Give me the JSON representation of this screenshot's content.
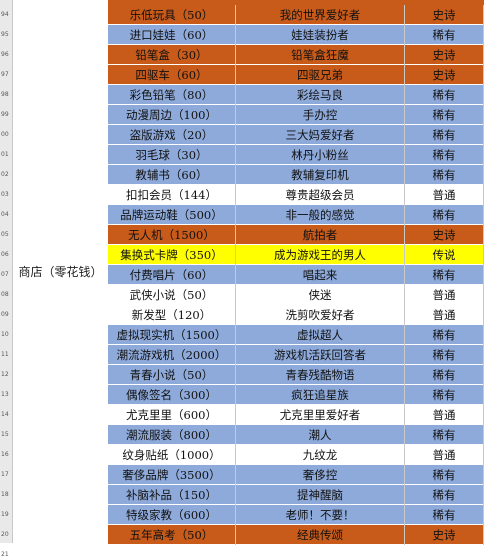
{
  "colors": {
    "orange": "#c85a1a",
    "blue": "#8eaadb",
    "white": "#ffffff",
    "yellow": "#ffff00"
  },
  "merged_label": "商店（零花钱）",
  "row_numbers": [
    "94",
    "95",
    "96",
    "97",
    "98",
    "99",
    "00",
    "01",
    "02",
    "03",
    "04",
    "05",
    "06",
    "07",
    "08",
    "09",
    "10",
    "11",
    "12",
    "13",
    "14",
    "15",
    "16",
    "17",
    "18",
    "19",
    "20",
    "21"
  ],
  "rows": [
    {
      "item": "乐低玩具（50）",
      "title": "我的世界爱好者",
      "rarity": "史诗",
      "color": "orange"
    },
    {
      "item": "进口娃娃（60）",
      "title": "娃娃装扮者",
      "rarity": "稀有",
      "color": "blue"
    },
    {
      "item": "铅笔盒（30）",
      "title": "铅笔盒狂魔",
      "rarity": "史诗",
      "color": "orange"
    },
    {
      "item": "四驱车（60）",
      "title": "四驱兄弟",
      "rarity": "史诗",
      "color": "orange"
    },
    {
      "item": "彩色铅笔（80）",
      "title": "彩绘马良",
      "rarity": "稀有",
      "color": "blue"
    },
    {
      "item": "动漫周边（100）",
      "title": "手办控",
      "rarity": "稀有",
      "color": "blue"
    },
    {
      "item": "盗版游戏（20）",
      "title": "三大妈爱好者",
      "rarity": "稀有",
      "color": "blue"
    },
    {
      "item": "羽毛球（30）",
      "title": "林丹小粉丝",
      "rarity": "稀有",
      "color": "blue"
    },
    {
      "item": "教辅书（60）",
      "title": "教辅复印机",
      "rarity": "稀有",
      "color": "blue"
    },
    {
      "item": "扣扣会员（144）",
      "title": "尊贵超级会员",
      "rarity": "普通",
      "color": "white"
    },
    {
      "item": "品牌运动鞋（500）",
      "title": "非一般的感觉",
      "rarity": "稀有",
      "color": "blue"
    },
    {
      "item": "无人机（1500）",
      "title": "航拍者",
      "rarity": "史诗",
      "color": "orange"
    },
    {
      "item": "集换式卡牌（350）",
      "title": "成为游戏王的男人",
      "rarity": "传说",
      "color": "yellow"
    },
    {
      "item": "付费唱片（60）",
      "title": "唱起来",
      "rarity": "稀有",
      "color": "blue"
    },
    {
      "item": "武侠小说（50）",
      "title": "侠迷",
      "rarity": "普通",
      "color": "white"
    },
    {
      "item": "新发型（120）",
      "title": "洗剪吹爱好者",
      "rarity": "普通",
      "color": "white"
    },
    {
      "item": "虚拟现实机（1500）",
      "title": "虚拟超人",
      "rarity": "稀有",
      "color": "blue"
    },
    {
      "item": "潮流游戏机（2000）",
      "title": "游戏机活跃回答者",
      "rarity": "稀有",
      "color": "blue"
    },
    {
      "item": "青春小说（50）",
      "title": "青春残酷物语",
      "rarity": "稀有",
      "color": "blue"
    },
    {
      "item": "偶像签名（300）",
      "title": "疯狂追星族",
      "rarity": "稀有",
      "color": "blue"
    },
    {
      "item": "尤克里里（600）",
      "title": "尤克里里爱好者",
      "rarity": "普通",
      "color": "white"
    },
    {
      "item": "潮流服装（800）",
      "title": "潮人",
      "rarity": "稀有",
      "color": "blue"
    },
    {
      "item": "纹身贴纸（1000）",
      "title": "九纹龙",
      "rarity": "普通",
      "color": "white"
    },
    {
      "item": "奢侈品牌（3500）",
      "title": "奢侈控",
      "rarity": "稀有",
      "color": "blue"
    },
    {
      "item": "补脑补品（150）",
      "title": "提神醒脑",
      "rarity": "稀有",
      "color": "blue"
    },
    {
      "item": "特级家教（600）",
      "title": "老师！不要！",
      "rarity": "稀有",
      "color": "blue"
    },
    {
      "item": "五年高考（50）",
      "title": "经典传颂",
      "rarity": "史诗",
      "color": "orange"
    }
  ]
}
